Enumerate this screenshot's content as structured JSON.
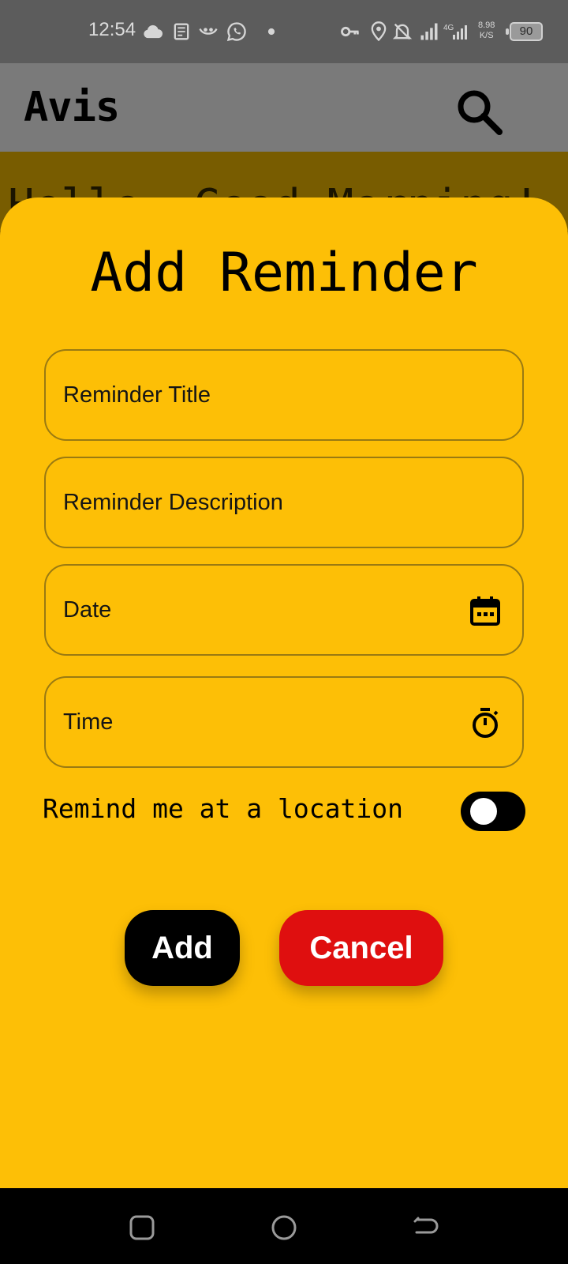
{
  "status_bar": {
    "time": "12:54",
    "speed_value": "8.98",
    "speed_unit": "K/S",
    "network": "4G",
    "battery": "90",
    "icons": [
      "cloud-icon",
      "sim-toolkit-icon",
      "app-notification-icon",
      "whatsapp-icon",
      "dot-icon",
      "vpn-key-icon",
      "location-icon",
      "notifications-off-icon",
      "signal-icon",
      "signal-4g-icon"
    ]
  },
  "app_bar": {
    "title": "Avis",
    "search_icon": "search-icon"
  },
  "background": {
    "greeting": "Hello, Good Morning!"
  },
  "dialog": {
    "title": "Add Reminder",
    "fields": {
      "title_placeholder": "Reminder Title",
      "description_placeholder": "Reminder Description",
      "date_placeholder": "Date",
      "date_icon": "calendar-icon",
      "time_placeholder": "Time",
      "time_icon": "stopwatch-icon"
    },
    "location_toggle": {
      "label": "Remind me at a location",
      "checked": false
    },
    "buttons": {
      "add": "Add",
      "cancel": "Cancel"
    }
  },
  "nav_bar": {
    "icons": [
      "recents-square-icon",
      "home-circle-icon",
      "back-arrow-icon"
    ]
  },
  "colors": {
    "sheet": "#fdbf06",
    "app_bar": "#7a7a7a",
    "cancel": "#df0f0f",
    "add": "#000000"
  }
}
